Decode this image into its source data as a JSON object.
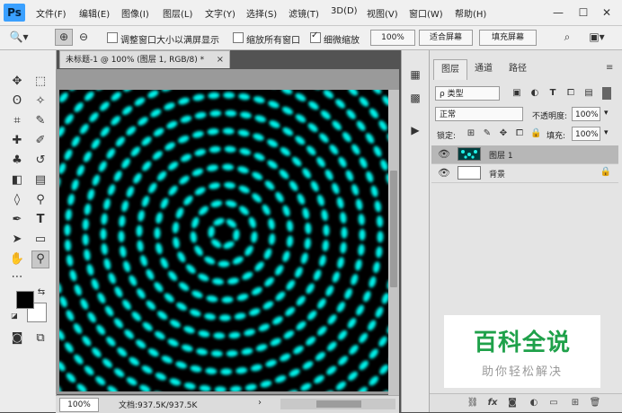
{
  "app": {
    "logo": "Ps"
  },
  "menu": [
    "文件(F)",
    "编辑(E)",
    "图像(I)",
    "图层(L)",
    "文字(Y)",
    "选择(S)",
    "滤镜(T)",
    "3D(D)",
    "视图(V)",
    "窗口(W)",
    "帮助(H)"
  ],
  "window_controls": {
    "minimize": "—",
    "maximize": "☐",
    "close": "✕"
  },
  "options": {
    "resize_windows_label": "调整窗口大小以满屏显示",
    "resize_windows_checked": false,
    "zoom_all_label": "缩放所有窗口",
    "zoom_all_checked": false,
    "scrubby_zoom_label": "细微缩放",
    "scrubby_zoom_checked": true,
    "zoom_value": "100%",
    "fit_screen": "适合屏幕",
    "fill_screen": "填充屏幕"
  },
  "document": {
    "tab_title": "未标题-1 @ 100% (图层 1, RGB/8) *",
    "tab_close": "×",
    "status_zoom": "100%",
    "status_info": "文档:937.5K/937.5K",
    "status_arrow": "›"
  },
  "colors": {
    "foreground": "#000000",
    "background": "#ffffff",
    "pattern_glow": "#00f2ea",
    "accent_ps": "#3aa0ff"
  },
  "layers_panel": {
    "tabs": [
      "图层",
      "通道",
      "路径"
    ],
    "active_tab": "图层",
    "kind_filter": "ρ 类型",
    "blend_mode": "正常",
    "opacity_label": "不透明度:",
    "opacity_value": "100%",
    "lock_label": "锁定:",
    "fill_label": "填充:",
    "fill_value": "100%",
    "layers": [
      {
        "name": "图层 1",
        "visible": true,
        "selected": true,
        "locked": false
      },
      {
        "name": "背景",
        "visible": true,
        "selected": false,
        "locked": true
      }
    ],
    "footer_icons": [
      "link-icon",
      "fx-icon",
      "mask-icon",
      "adjustment-icon",
      "group-icon",
      "new-layer-icon",
      "trash-icon"
    ]
  },
  "watermark": {
    "title": "百科全说",
    "subtitle": "助你轻松解决"
  }
}
